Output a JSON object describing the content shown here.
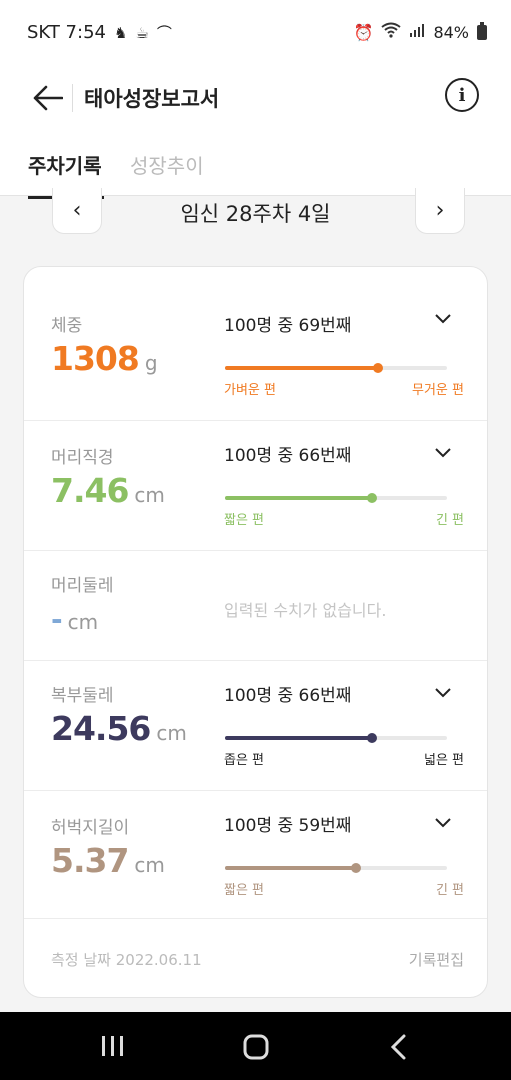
{
  "status_bar": {
    "carrier_time": "SKT 7:54",
    "battery": "84%"
  },
  "header": {
    "title": "태아성장보고서",
    "info_glyph": "i"
  },
  "tabs": [
    {
      "label": "주차기록",
      "active": true
    },
    {
      "label": "성장추이",
      "active": false
    }
  ],
  "week": {
    "title": "임신 28주차 4일",
    "prev_glyph": "‹",
    "next_glyph": "›"
  },
  "metrics": [
    {
      "label": "체중",
      "value": "1308",
      "unit": "g",
      "rank": "100명 중 69번째",
      "percentile": 0.69,
      "low_label": "가벼운 편",
      "high_label": "무거운 편",
      "color": "#f07a22"
    },
    {
      "label": "머리직경",
      "value": "7.46",
      "unit": "cm",
      "rank": "100명 중 66번째",
      "percentile": 0.66,
      "low_label": "짧은 편",
      "high_label": "긴 편",
      "color": "#8cc063"
    },
    {
      "label": "머리둘레",
      "value": "-",
      "unit": "cm",
      "empty_message": "입력된 수치가 없습니다.",
      "color": "#7fa8d6"
    },
    {
      "label": "복부둘레",
      "value": "24.56",
      "unit": "cm",
      "rank": "100명 중 66번째",
      "percentile": 0.66,
      "low_label": "좁은 편",
      "high_label": "넓은 편",
      "color": "#3d3a5e"
    },
    {
      "label": "허벅지길이",
      "value": "5.37",
      "unit": "cm",
      "rank": "100명 중 59번째",
      "percentile": 0.59,
      "low_label": "짧은 편",
      "high_label": "긴 편",
      "color": "#b09580"
    }
  ],
  "footer": {
    "measure_date": "측정 날짜 2022.06.11",
    "edit_label": "기록편집"
  }
}
